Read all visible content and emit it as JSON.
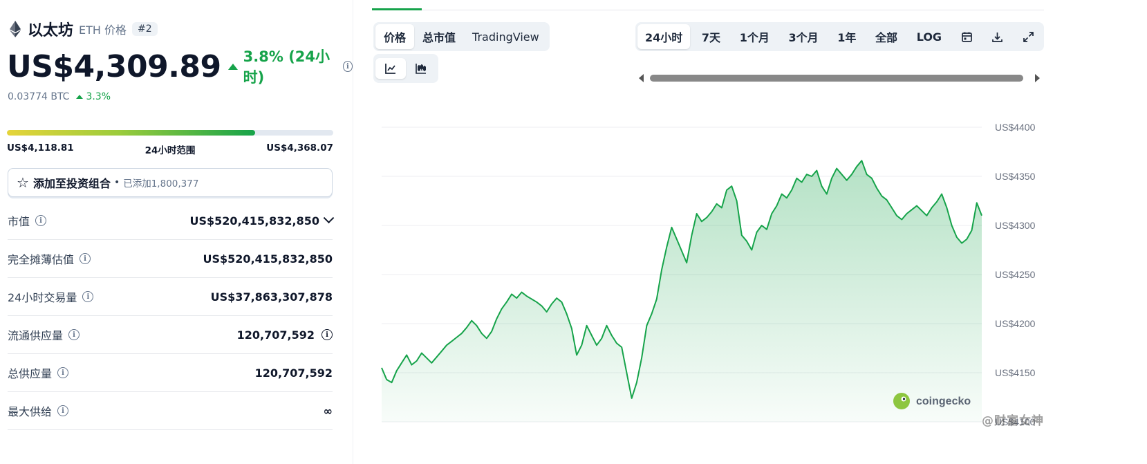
{
  "coin": {
    "name": "以太坊",
    "symbol_label": "ETH 价格",
    "rank": "#2",
    "price": "US$4,309.89",
    "change_24h": "3.8% (24小时)",
    "btc_price": "0.03774 BTC",
    "btc_change": "3.3%",
    "accent_color": "#16a34a"
  },
  "range_24h": {
    "low": "US$4,118.81",
    "label": "24小时范围",
    "high": "US$4,368.07",
    "fill_percent": 76
  },
  "portfolio": {
    "label": "添加至投资组合",
    "count": "已添加1,800,377"
  },
  "stats": [
    {
      "label": "市值",
      "value": "US$520,415,832,850",
      "has_info": true,
      "has_chevron": true
    },
    {
      "label": "完全摊薄估值",
      "value": "US$520,415,832,850",
      "has_info": true
    },
    {
      "label": "24小时交易量",
      "value": "US$37,863,307,878",
      "has_info": true
    },
    {
      "label": "流通供应量",
      "value": "120,707,592",
      "has_info": true,
      "value_info": true
    },
    {
      "label": "总供应量",
      "value": "120,707,592",
      "has_info": true
    },
    {
      "label": "最大供给",
      "value": "∞",
      "has_info": true
    }
  ],
  "chart_tabs": {
    "type": [
      "价格",
      "总市值",
      "TradingView"
    ],
    "type_active": 0,
    "ranges": [
      "24小时",
      "7天",
      "1个月",
      "3个月",
      "1年",
      "全部",
      "LOG"
    ],
    "range_active": 0,
    "icons": [
      "calendar-icon",
      "download-icon",
      "expand-icon"
    ],
    "modes": [
      "line-chart-icon",
      "candlestick-icon"
    ]
  },
  "chart_data": {
    "type": "area",
    "title": "",
    "xlabel": "",
    "ylabel": "",
    "ylim": [
      4100,
      4400
    ],
    "y_ticks": [
      4100,
      4150,
      4200,
      4250,
      4300,
      4350,
      4400
    ],
    "y_tick_labels": [
      "US$4100",
      "US$4150",
      "US$4200",
      "US$4250",
      "US$4300",
      "US$4350",
      "US$4400"
    ],
    "x": [
      0,
      1,
      2,
      3,
      4,
      5,
      6,
      7,
      8,
      9,
      10,
      11,
      12,
      13,
      14,
      15,
      16,
      17,
      18,
      19,
      20,
      21,
      22,
      23,
      24,
      25,
      26,
      27,
      28,
      29,
      30,
      31,
      32,
      33,
      34,
      35,
      36,
      37,
      38,
      39,
      40,
      41,
      42,
      43,
      44,
      45,
      46,
      47,
      48,
      49,
      50,
      51,
      52,
      53,
      54,
      55,
      56,
      57,
      58,
      59,
      60,
      61,
      62,
      63,
      64,
      65,
      66,
      67,
      68,
      69,
      70,
      71,
      72,
      73,
      74,
      75,
      76,
      77,
      78,
      79,
      80,
      81,
      82,
      83,
      84,
      85,
      86,
      87,
      88,
      89,
      90,
      91,
      92,
      93,
      94,
      95,
      96,
      97,
      98,
      99,
      100,
      101,
      102,
      103,
      104,
      105,
      106,
      107,
      108,
      109,
      110,
      111,
      112,
      113,
      114,
      115,
      116,
      117,
      118,
      119,
      120
    ],
    "values": [
      4155,
      4143,
      4140,
      4152,
      4160,
      4168,
      4158,
      4162,
      4170,
      4165,
      4160,
      4166,
      4172,
      4178,
      4182,
      4186,
      4190,
      4196,
      4203,
      4198,
      4190,
      4185,
      4192,
      4205,
      4215,
      4222,
      4230,
      4226,
      4232,
      4228,
      4225,
      4222,
      4218,
      4212,
      4220,
      4226,
      4222,
      4210,
      4195,
      4168,
      4178,
      4198,
      4188,
      4178,
      4185,
      4198,
      4188,
      4180,
      4176,
      4150,
      4124,
      4140,
      4165,
      4198,
      4210,
      4225,
      4255,
      4278,
      4298,
      4286,
      4274,
      4262,
      4290,
      4312,
      4304,
      4308,
      4314,
      4322,
      4318,
      4336,
      4340,
      4325,
      4290,
      4284,
      4275,
      4293,
      4300,
      4296,
      4312,
      4320,
      4332,
      4328,
      4336,
      4348,
      4344,
      4352,
      4350,
      4356,
      4340,
      4332,
      4348,
      4358,
      4352,
      4346,
      4352,
      4360,
      4366,
      4352,
      4348,
      4338,
      4330,
      4326,
      4318,
      4310,
      4306,
      4312,
      4316,
      4320,
      4315,
      4310,
      4318,
      4324,
      4332,
      4318,
      4300,
      4288,
      4282,
      4286,
      4295,
      4323,
      4310
    ],
    "series_color": "#16a34a",
    "grid": true,
    "y_axis_position": "right",
    "logo_text": "coingecko"
  },
  "watermark": "@财富女神"
}
